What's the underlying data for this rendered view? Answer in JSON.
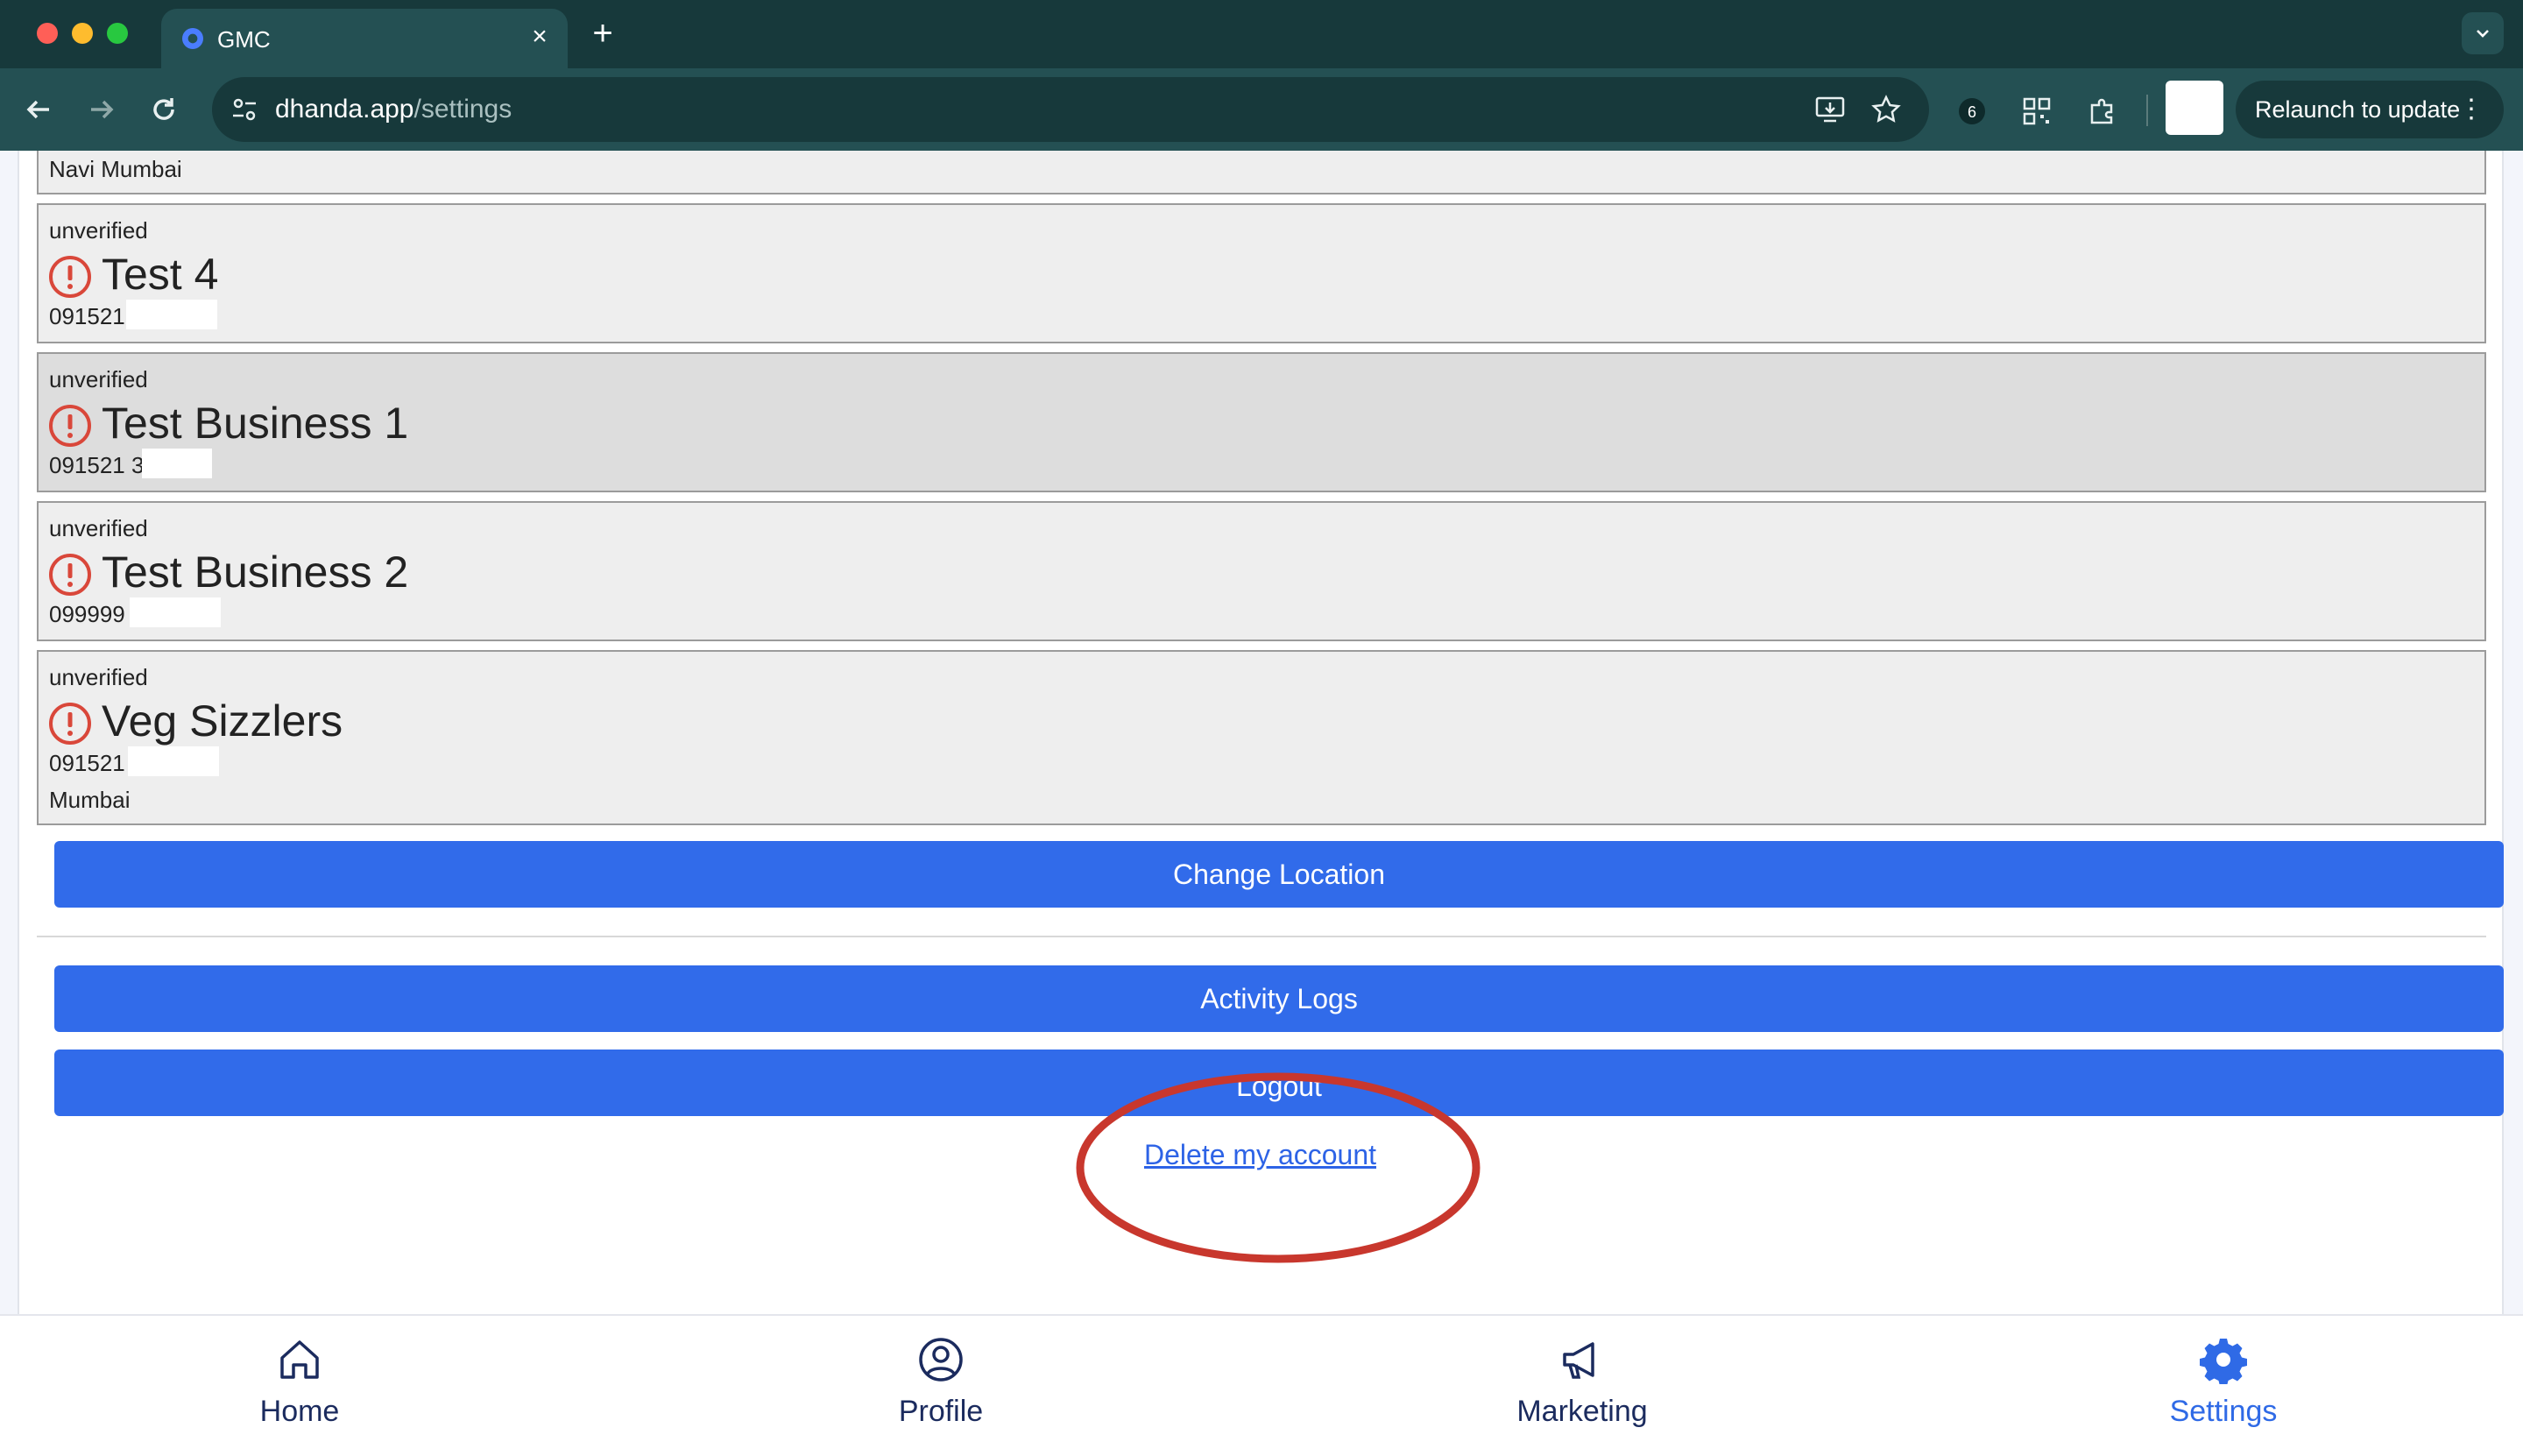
{
  "browser": {
    "tab_title": "GMC",
    "url_host": "dhanda.app",
    "url_path": "/settings",
    "relaunch_label": "Relaunch to update",
    "new_tab_glyph": "+",
    "close_glyph": "×"
  },
  "businesses": [
    {
      "status": "",
      "name": "",
      "phone": "",
      "city": "Navi Mumbai"
    },
    {
      "status": "unverified",
      "name": "Test 4",
      "phone": "091521",
      "city": ""
    },
    {
      "status": "unverified",
      "name": "Test Business 1",
      "phone": "091521 3",
      "city": ""
    },
    {
      "status": "unverified",
      "name": "Test Business 2",
      "phone": "099999",
      "city": ""
    },
    {
      "status": "unverified",
      "name": "Veg Sizzlers",
      "phone": "091521",
      "city": "Mumbai"
    }
  ],
  "actions": {
    "change_location": "Change Location",
    "activity_logs": "Activity Logs",
    "logout": "Logout",
    "delete_account": "Delete my account"
  },
  "bottom_nav": [
    {
      "label": "Home",
      "icon": "home-icon"
    },
    {
      "label": "Profile",
      "icon": "profile-icon"
    },
    {
      "label": "Marketing",
      "icon": "megaphone-icon"
    },
    {
      "label": "Settings",
      "icon": "gear-icon",
      "active": true
    }
  ],
  "colors": {
    "accent": "#316bea",
    "alert": "#d9473a",
    "annotation": "#c8372d",
    "chrome": "#17393b"
  }
}
